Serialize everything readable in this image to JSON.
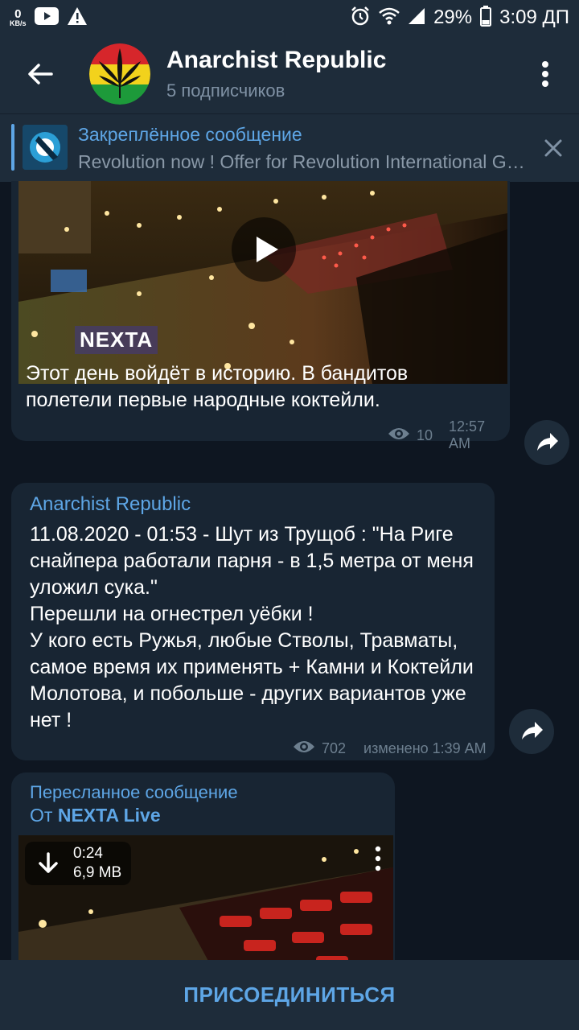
{
  "status_bar": {
    "net_speed": "0",
    "net_unit": "KB/s",
    "battery": "29%",
    "time": "3:09 ДП",
    "icons": [
      "youtube-icon",
      "warning-icon",
      "alarm-icon",
      "wifi-icon",
      "signal-icon",
      "battery-icon"
    ]
  },
  "header": {
    "title": "Anarchist Republic",
    "subtitle": "5 подписчиков",
    "icons": [
      "back-arrow-icon",
      "channel-avatar",
      "more-vert-icon"
    ]
  },
  "pinned": {
    "title": "Закреплённое сообщение",
    "text": "Revolution now ! Offer for Revolution International Group (RIG)",
    "icons": [
      "pinned-thumbnail",
      "close-icon"
    ]
  },
  "messages": [
    {
      "type": "video",
      "video_logo": "NEXTA",
      "text": "Этот день войдёт в историю. В бандитов полетели первые народные коктейли.",
      "views": "10",
      "time": "12:57 AM"
    },
    {
      "type": "text",
      "author": "Anarchist Republic",
      "text": "11.08.2020 - 01:53 - Шут из Трущоб : \"На Риге снайпера работали парня - в 1,5 метра от меня уложил сука.\"\nПерешли на огнестрел уёбки !\nУ кого есть Ружья, любые Стволы, Травматы, самое время их применять + Камни и Коктейли Молотова, и побольше - других вариантов уже нет !",
      "views": "702",
      "time": "изменено 1:39 AM"
    },
    {
      "type": "forwarded_video",
      "forward_label": "Пересланное сообщение",
      "from_prefix": "От",
      "from_name": "NEXTA Live",
      "duration": "0:24",
      "size": "6,9 MB"
    }
  ],
  "join_button": "ПРИСОЕДИНИТЬСЯ",
  "colors": {
    "background": "#0e1621",
    "bar": "#1e2c3a",
    "bubble": "#182533",
    "accent": "#5ea6e6",
    "meta": "#6d7f8f"
  }
}
